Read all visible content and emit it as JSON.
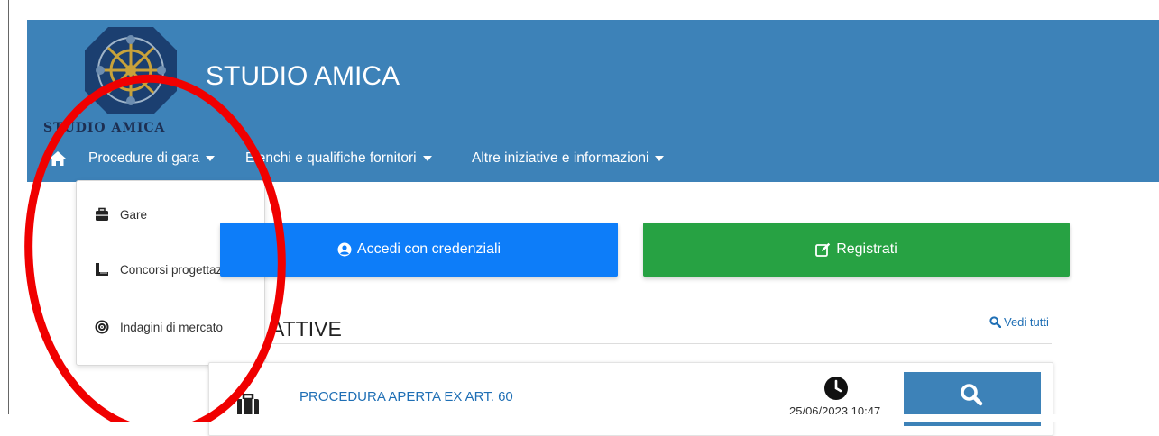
{
  "header": {
    "logo_text": "STUDIO AMICA",
    "brand_title": "STUDIO AMICA",
    "bg_color": "#3d82b8"
  },
  "nav": {
    "home_icon": "home-icon",
    "items": [
      {
        "label": "Procedure di gara"
      },
      {
        "label": "Elenchi e qualifiche fornitori"
      },
      {
        "label": "Altre iniziative e informazioni"
      }
    ]
  },
  "dropdown": {
    "items": [
      {
        "label": "Gare",
        "icon": "briefcase-icon"
      },
      {
        "label": "Concorsi progettazione",
        "icon": "ruler-icon"
      },
      {
        "label": "Indagini di mercato",
        "icon": "target-icon"
      }
    ]
  },
  "buttons": {
    "login_label": "Accedi con credenziali",
    "register_label": "Registrati",
    "login_color": "#0d7df9",
    "register_color": "#27a243"
  },
  "section": {
    "title": "ATTIVE",
    "see_all_label": "Vedi tutti"
  },
  "card": {
    "title": "PROCEDURA APERTA EX ART. 60",
    "date": "25/06/2023 10:47"
  },
  "annotation": {
    "color": "#ff0000"
  }
}
